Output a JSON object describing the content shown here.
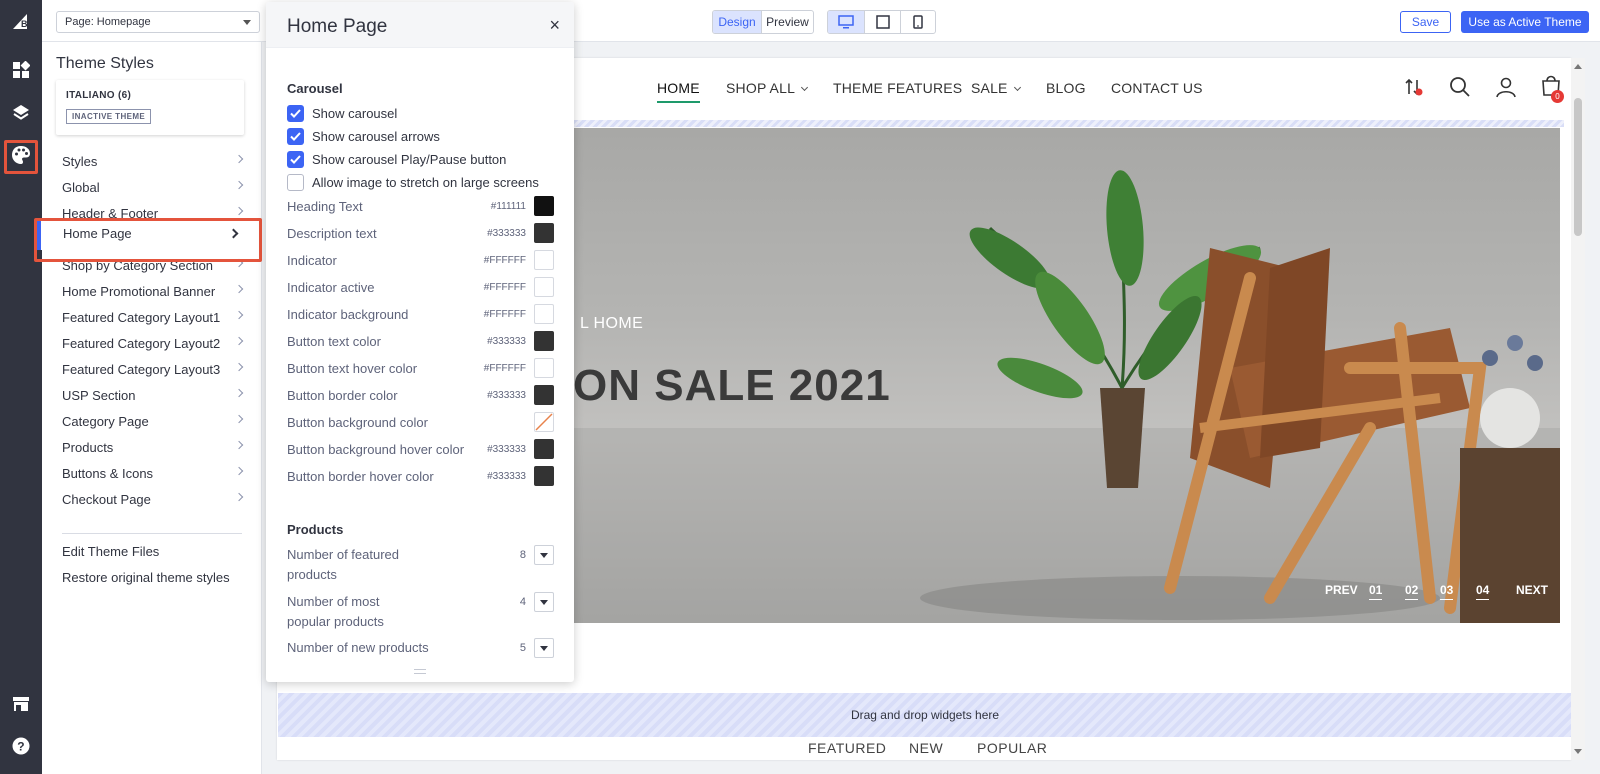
{
  "topbar": {
    "page_select": "Page: Homepage",
    "mode_tabs": [
      "Design",
      "Preview"
    ],
    "save": "Save",
    "use_active": "Use as Active Theme"
  },
  "sidebar": {
    "title": "Theme Styles",
    "theme_name": "ITALIANO (6)",
    "theme_badge": "INACTIVE THEME",
    "items": [
      "Styles",
      "Global",
      "Header & Footer",
      "Home Page",
      "Shop by Category Section",
      "Home Promotional Banner",
      "Featured Category Layout1",
      "Featured Category Layout2",
      "Featured Category Layout3",
      "USP Section",
      "Category Page",
      "Products",
      "Buttons & Icons",
      "Checkout Page"
    ],
    "links": [
      "Edit Theme Files",
      "Restore original theme styles"
    ]
  },
  "panel": {
    "title": "Home Page",
    "close": "×",
    "carousel_title": "Carousel",
    "checkboxes": [
      {
        "label": "Show carousel",
        "checked": true
      },
      {
        "label": "Show carousel arrows",
        "checked": true
      },
      {
        "label": "Show carousel Play/Pause button",
        "checked": true
      },
      {
        "label": "Allow image to stretch on large screens",
        "checked": false
      }
    ],
    "colors": [
      {
        "label": "Heading Text",
        "hex": "#111111",
        "swatch": "#111111"
      },
      {
        "label": "Description text",
        "hex": "#333333",
        "swatch": "#333333"
      },
      {
        "label": "Indicator",
        "hex": "#FFFFFF",
        "swatch": "#FFFFFF"
      },
      {
        "label": "Indicator active",
        "hex": "#FFFFFF",
        "swatch": "#FFFFFF"
      },
      {
        "label": "Indicator background",
        "hex": "#FFFFFF",
        "swatch": "#FFFFFF"
      },
      {
        "label": "Button text color",
        "hex": "#333333",
        "swatch": "#333333"
      },
      {
        "label": "Button text hover color",
        "hex": "#FFFFFF",
        "swatch": "#FFFFFF"
      },
      {
        "label": "Button border color",
        "hex": "#333333",
        "swatch": "#333333"
      },
      {
        "label": "Button background color",
        "hex": "",
        "swatch": "transparent"
      },
      {
        "label": "Button background hover color",
        "hex": "#333333",
        "swatch": "#333333"
      },
      {
        "label": "Button border hover color",
        "hex": "#333333",
        "swatch": "#333333"
      }
    ],
    "products_title": "Products",
    "products": [
      {
        "label": "Number of featured products",
        "value": "8"
      },
      {
        "label": "Number of most popular products",
        "value": "4"
      },
      {
        "label": "Number of new products",
        "value": "5"
      }
    ]
  },
  "store": {
    "nav": [
      "HOME",
      "SHOP ALL",
      "THEME FEATURES",
      "SALE",
      "BLOG",
      "CONTACT US"
    ],
    "cart_count": "0",
    "hero_subtitle": "L HOME",
    "hero_title": "ON SALE 2021",
    "carousel": [
      "PREV",
      "01",
      "02",
      "03",
      "04",
      "NEXT"
    ],
    "dropzone": "Drag and drop widgets here",
    "tabs": [
      "FEATURED",
      "NEW",
      "POPULAR"
    ]
  },
  "colors": {
    "accent": "#3c64f4",
    "rail": "#313440",
    "highlight": "#e4543c",
    "nav_active_underline": "#1e9a6b"
  }
}
